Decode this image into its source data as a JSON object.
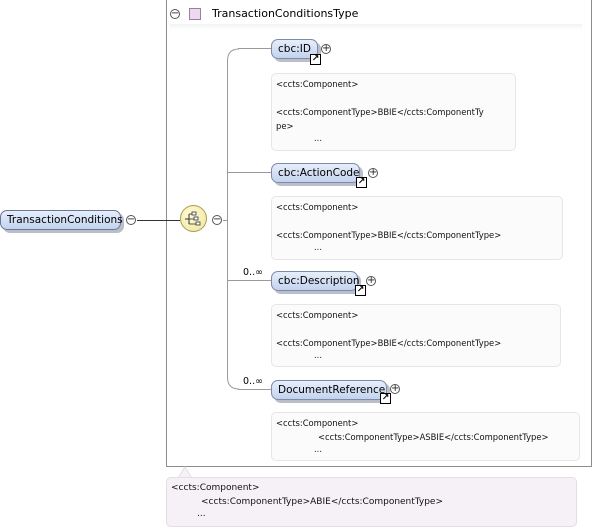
{
  "root": {
    "name": "TransactionConditions",
    "collapse_symbol": "−"
  },
  "type_box": {
    "title": "TransactionConditionsType",
    "collapse_symbol": "−"
  },
  "compositor": {
    "kind": "sequence",
    "icon": "sequence-compositor-icon",
    "collapse_symbol": "−"
  },
  "elements": [
    {
      "name": "cbc:ID",
      "cardinality": "",
      "expand_symbol": "+",
      "link_symbol": "↗",
      "annotation": [
        "<ccts:Component>",
        "",
        "<ccts:ComponentType>BBIE</ccts:ComponentTy",
        "pe>",
        "..."
      ]
    },
    {
      "name": "cbc:ActionCode",
      "cardinality": "",
      "expand_symbol": "+",
      "link_symbol": "↗",
      "annotation": [
        "<ccts:Component>",
        "",
        "<ccts:ComponentType>BBIE</ccts:ComponentType>",
        "..."
      ]
    },
    {
      "name": "cbc:Description",
      "cardinality": "0..∞",
      "expand_symbol": "+",
      "link_symbol": "↗",
      "annotation": [
        "<ccts:Component>",
        "",
        "<ccts:ComponentType>BBIE</ccts:ComponentType>",
        "..."
      ]
    },
    {
      "name": "DocumentReference",
      "cardinality": "0..∞",
      "expand_symbol": "+",
      "link_symbol": "↗",
      "annotation": [
        "<ccts:Component>",
        "<ccts:ComponentType>ASBIE</ccts:ComponentType>",
        "..."
      ]
    }
  ],
  "type_annotation": [
    "<ccts:Component>",
    "<ccts:ComponentType>ABIE</ccts:ComponentType>",
    "..."
  ],
  "colors": {
    "pill_top": "#e6eefb",
    "pill_bottom": "#c3d3ee",
    "pill_border": "#7d8aa8",
    "type_icon": "#ecd9ef",
    "sequence": "#efe39b"
  }
}
